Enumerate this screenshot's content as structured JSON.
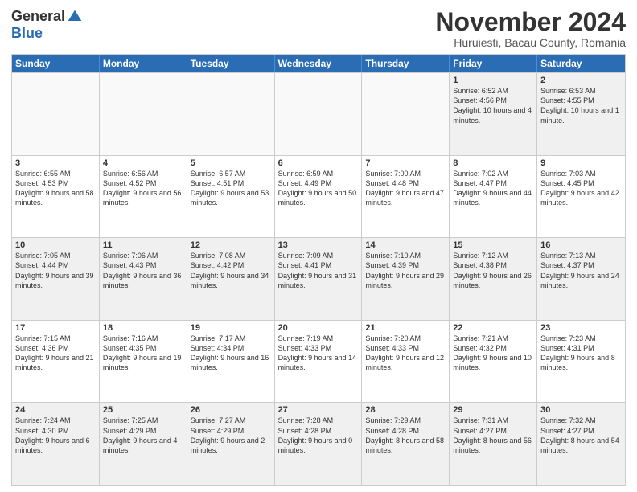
{
  "header": {
    "logo_general": "General",
    "logo_blue": "Blue",
    "month_title": "November 2024",
    "location": "Huruiesti, Bacau County, Romania"
  },
  "days_of_week": [
    "Sunday",
    "Monday",
    "Tuesday",
    "Wednesday",
    "Thursday",
    "Friday",
    "Saturday"
  ],
  "weeks": [
    [
      {
        "day": "",
        "info": "",
        "empty": true
      },
      {
        "day": "",
        "info": "",
        "empty": true
      },
      {
        "day": "",
        "info": "",
        "empty": true
      },
      {
        "day": "",
        "info": "",
        "empty": true
      },
      {
        "day": "",
        "info": "",
        "empty": true
      },
      {
        "day": "1",
        "info": "Sunrise: 6:52 AM\nSunset: 4:56 PM\nDaylight: 10 hours and 4 minutes.",
        "empty": false
      },
      {
        "day": "2",
        "info": "Sunrise: 6:53 AM\nSunset: 4:55 PM\nDaylight: 10 hours and 1 minute.",
        "empty": false
      }
    ],
    [
      {
        "day": "3",
        "info": "Sunrise: 6:55 AM\nSunset: 4:53 PM\nDaylight: 9 hours and 58 minutes.",
        "empty": false
      },
      {
        "day": "4",
        "info": "Sunrise: 6:56 AM\nSunset: 4:52 PM\nDaylight: 9 hours and 56 minutes.",
        "empty": false
      },
      {
        "day": "5",
        "info": "Sunrise: 6:57 AM\nSunset: 4:51 PM\nDaylight: 9 hours and 53 minutes.",
        "empty": false
      },
      {
        "day": "6",
        "info": "Sunrise: 6:59 AM\nSunset: 4:49 PM\nDaylight: 9 hours and 50 minutes.",
        "empty": false
      },
      {
        "day": "7",
        "info": "Sunrise: 7:00 AM\nSunset: 4:48 PM\nDaylight: 9 hours and 47 minutes.",
        "empty": false
      },
      {
        "day": "8",
        "info": "Sunrise: 7:02 AM\nSunset: 4:47 PM\nDaylight: 9 hours and 44 minutes.",
        "empty": false
      },
      {
        "day": "9",
        "info": "Sunrise: 7:03 AM\nSunset: 4:45 PM\nDaylight: 9 hours and 42 minutes.",
        "empty": false
      }
    ],
    [
      {
        "day": "10",
        "info": "Sunrise: 7:05 AM\nSunset: 4:44 PM\nDaylight: 9 hours and 39 minutes.",
        "empty": false
      },
      {
        "day": "11",
        "info": "Sunrise: 7:06 AM\nSunset: 4:43 PM\nDaylight: 9 hours and 36 minutes.",
        "empty": false
      },
      {
        "day": "12",
        "info": "Sunrise: 7:08 AM\nSunset: 4:42 PM\nDaylight: 9 hours and 34 minutes.",
        "empty": false
      },
      {
        "day": "13",
        "info": "Sunrise: 7:09 AM\nSunset: 4:41 PM\nDaylight: 9 hours and 31 minutes.",
        "empty": false
      },
      {
        "day": "14",
        "info": "Sunrise: 7:10 AM\nSunset: 4:39 PM\nDaylight: 9 hours and 29 minutes.",
        "empty": false
      },
      {
        "day": "15",
        "info": "Sunrise: 7:12 AM\nSunset: 4:38 PM\nDaylight: 9 hours and 26 minutes.",
        "empty": false
      },
      {
        "day": "16",
        "info": "Sunrise: 7:13 AM\nSunset: 4:37 PM\nDaylight: 9 hours and 24 minutes.",
        "empty": false
      }
    ],
    [
      {
        "day": "17",
        "info": "Sunrise: 7:15 AM\nSunset: 4:36 PM\nDaylight: 9 hours and 21 minutes.",
        "empty": false
      },
      {
        "day": "18",
        "info": "Sunrise: 7:16 AM\nSunset: 4:35 PM\nDaylight: 9 hours and 19 minutes.",
        "empty": false
      },
      {
        "day": "19",
        "info": "Sunrise: 7:17 AM\nSunset: 4:34 PM\nDaylight: 9 hours and 16 minutes.",
        "empty": false
      },
      {
        "day": "20",
        "info": "Sunrise: 7:19 AM\nSunset: 4:33 PM\nDaylight: 9 hours and 14 minutes.",
        "empty": false
      },
      {
        "day": "21",
        "info": "Sunrise: 7:20 AM\nSunset: 4:33 PM\nDaylight: 9 hours and 12 minutes.",
        "empty": false
      },
      {
        "day": "22",
        "info": "Sunrise: 7:21 AM\nSunset: 4:32 PM\nDaylight: 9 hours and 10 minutes.",
        "empty": false
      },
      {
        "day": "23",
        "info": "Sunrise: 7:23 AM\nSunset: 4:31 PM\nDaylight: 9 hours and 8 minutes.",
        "empty": false
      }
    ],
    [
      {
        "day": "24",
        "info": "Sunrise: 7:24 AM\nSunset: 4:30 PM\nDaylight: 9 hours and 6 minutes.",
        "empty": false
      },
      {
        "day": "25",
        "info": "Sunrise: 7:25 AM\nSunset: 4:29 PM\nDaylight: 9 hours and 4 minutes.",
        "empty": false
      },
      {
        "day": "26",
        "info": "Sunrise: 7:27 AM\nSunset: 4:29 PM\nDaylight: 9 hours and 2 minutes.",
        "empty": false
      },
      {
        "day": "27",
        "info": "Sunrise: 7:28 AM\nSunset: 4:28 PM\nDaylight: 9 hours and 0 minutes.",
        "empty": false
      },
      {
        "day": "28",
        "info": "Sunrise: 7:29 AM\nSunset: 4:28 PM\nDaylight: 8 hours and 58 minutes.",
        "empty": false
      },
      {
        "day": "29",
        "info": "Sunrise: 7:31 AM\nSunset: 4:27 PM\nDaylight: 8 hours and 56 minutes.",
        "empty": false
      },
      {
        "day": "30",
        "info": "Sunrise: 7:32 AM\nSunset: 4:27 PM\nDaylight: 8 hours and 54 minutes.",
        "empty": false
      }
    ]
  ]
}
